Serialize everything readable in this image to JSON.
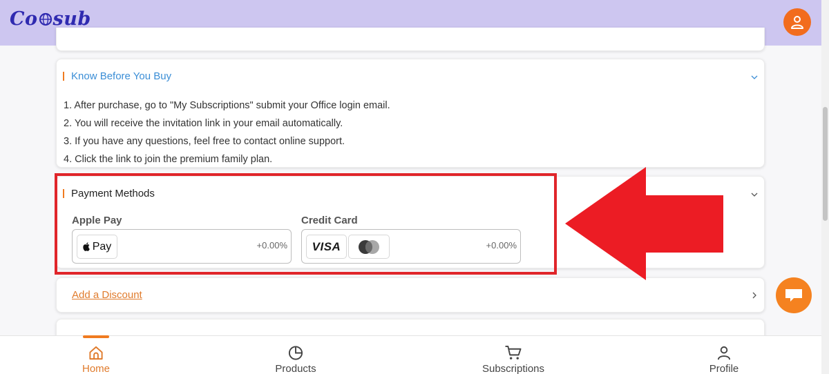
{
  "app": {
    "logo_text_before": "Co",
    "logo_text_after": "sub"
  },
  "know_section": {
    "title": "Know Before You Buy",
    "items": [
      "1. After purchase, go to \"My Subscriptions\" submit your Office login email.",
      "2. You will receive the invitation link in your email automatically.",
      "3. If you have any questions, feel free to contact online support.",
      "4. Click the link to join the premium family plan."
    ]
  },
  "payment_section": {
    "title": "Payment Methods",
    "methods": [
      {
        "label": "Apple Pay",
        "brand_text": "Pay",
        "fee": "+0.00%"
      },
      {
        "label": "Credit Card",
        "brand_text": "VISA",
        "fee": "+0.00%"
      }
    ]
  },
  "discount": {
    "label": "Add a Discount"
  },
  "nav": {
    "items": [
      {
        "label": "Home",
        "icon": "home-icon",
        "active": true
      },
      {
        "label": "Products",
        "icon": "pie-chart-icon",
        "active": false
      },
      {
        "label": "Subscriptions",
        "icon": "cart-icon",
        "active": false
      },
      {
        "label": "Profile",
        "icon": "user-icon",
        "active": false
      }
    ]
  },
  "colors": {
    "header_bg": "#cdc6f0",
    "accent_orange": "#f07b20",
    "logo_blue": "#2f2ab0",
    "title_blue": "#3b8ed6",
    "highlight_red": "#e0252a"
  }
}
